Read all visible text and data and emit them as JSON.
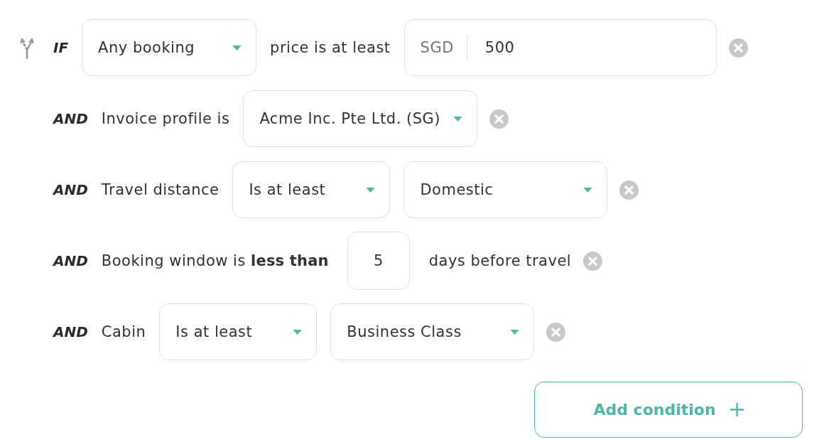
{
  "conditions": [
    {
      "keyword": "IF",
      "parts": [
        {
          "kind": "select",
          "value": "Any booking"
        },
        {
          "kind": "text",
          "text": "price is at least"
        },
        {
          "kind": "amount",
          "currency": "SGD",
          "value": "500"
        }
      ]
    },
    {
      "keyword": "AND",
      "parts": [
        {
          "kind": "text",
          "text": "Invoice profile is"
        },
        {
          "kind": "select",
          "value": "Acme Inc. Pte Ltd. (SG)"
        }
      ]
    },
    {
      "keyword": "AND",
      "parts": [
        {
          "kind": "text",
          "text": "Travel distance"
        },
        {
          "kind": "select",
          "value": "Is at least"
        },
        {
          "kind": "select",
          "value": "Domestic"
        }
      ]
    },
    {
      "keyword": "AND",
      "parts": [
        {
          "kind": "text",
          "text": "Booking window is **less than**"
        },
        {
          "kind": "number",
          "value": "5"
        },
        {
          "kind": "text",
          "text": "days before travel"
        }
      ]
    },
    {
      "keyword": "AND",
      "parts": [
        {
          "kind": "text",
          "text": "Cabin"
        },
        {
          "kind": "select",
          "value": "Is at least"
        },
        {
          "kind": "select",
          "value": "Business Class"
        }
      ]
    }
  ],
  "add_button": {
    "label": "Add condition"
  }
}
